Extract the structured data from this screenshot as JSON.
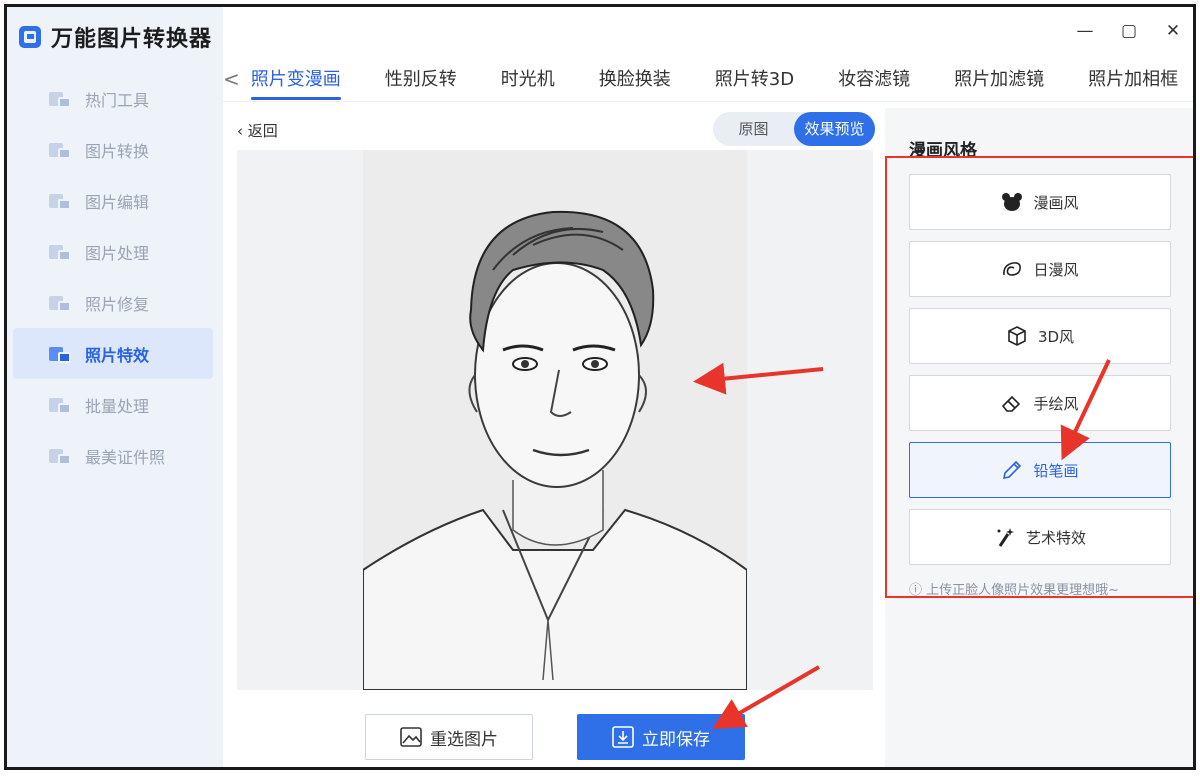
{
  "app": {
    "title": "万能图片转换器"
  },
  "window_controls": {
    "minimize": "—",
    "maximize": "▢",
    "close": "✕"
  },
  "sidebar": {
    "items": [
      {
        "label": "热门工具"
      },
      {
        "label": "图片转换"
      },
      {
        "label": "图片编辑"
      },
      {
        "label": "图片处理"
      },
      {
        "label": "照片修复"
      },
      {
        "label": "照片特效",
        "active": true
      },
      {
        "label": "批量处理"
      },
      {
        "label": "最美证件照"
      }
    ]
  },
  "tabs": {
    "prev": "<",
    "items": [
      "照片变漫画",
      "性别反转",
      "时光机",
      "换脸换装",
      "照片转3D",
      "妆容滤镜",
      "照片加滤镜",
      "照片加相框"
    ],
    "active_index": 0
  },
  "preview": {
    "back_label": "返回",
    "toggle": {
      "original": "原图",
      "effect": "效果预览",
      "selected": "效果预览"
    }
  },
  "actions": {
    "reselect": "重选图片",
    "save": "立即保存"
  },
  "styles_panel": {
    "title": "漫画风格",
    "options": [
      {
        "label": "漫画风",
        "icon": "bear-icon"
      },
      {
        "label": "日漫风",
        "icon": "swirl-leaf-icon"
      },
      {
        "label": "3D风",
        "icon": "cube-icon"
      },
      {
        "label": "手绘风",
        "icon": "eraser-icon"
      },
      {
        "label": "铅笔画",
        "icon": "pencil-icon",
        "selected": true
      },
      {
        "label": "艺术特效",
        "icon": "magic-wand-icon"
      }
    ],
    "hint": "上传正脸人像照片效果更理想哦~"
  },
  "colors": {
    "accent": "#2f6fe8",
    "annotation": "#e8342a"
  }
}
